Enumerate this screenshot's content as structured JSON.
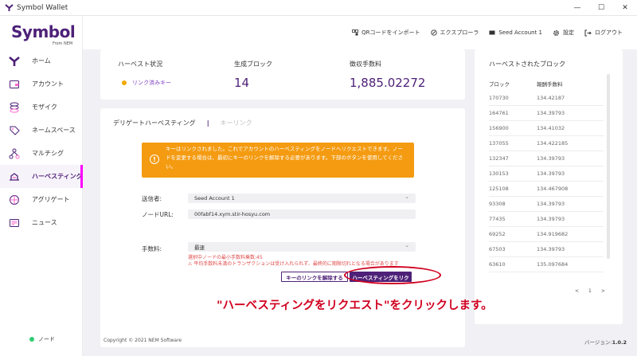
{
  "window": {
    "title": "Symbol Wallet",
    "minimize": "—",
    "maximize": "☐",
    "close": "✕"
  },
  "logo": {
    "word": "Symbol",
    "from": "From NEM"
  },
  "colors": {
    "brand": "#4e2178",
    "accent": "#ff00ff",
    "warning": "#f49b11",
    "annotation": "#d1001f",
    "link_dot": "#f2a900",
    "node_dot": "#2ecc71"
  },
  "sidebar": {
    "items": [
      {
        "label": "ホーム",
        "icon": "home-icon"
      },
      {
        "label": "アカウント",
        "icon": "account-icon"
      },
      {
        "label": "モザイク",
        "icon": "mosaic-icon"
      },
      {
        "label": "ネームスペース",
        "icon": "tag-icon"
      },
      {
        "label": "マルチシグ",
        "icon": "multisig-icon"
      },
      {
        "label": "ハーベスティング",
        "icon": "harvesting-icon"
      },
      {
        "label": "アグリゲート",
        "icon": "aggregate-icon"
      },
      {
        "label": "ニュース",
        "icon": "news-icon"
      }
    ],
    "active": "ハーベスティング",
    "node_label": "ノード"
  },
  "topbar": {
    "qr_import": "QRコードをインポート",
    "explorer": "エクスプローラ",
    "account": "Seed Account 1",
    "settings": "設定",
    "logout": "ログアウト"
  },
  "stats": {
    "status_label": "ハーベスト状況",
    "status_value": "リンク済みキー",
    "blocks_label": "生成ブロック",
    "blocks_value": "14",
    "fees_label": "徴収手数料",
    "fees_value": "1,885.02272"
  },
  "harvest": {
    "tab_delegated": "デリゲートハーベスティング",
    "tab_keylink": "キーリンク",
    "alert_text": "キーはリンクされました。これでアカウントのハーベスティングをノードへリクエストできます。ノードを変更する場合は、最初にキーのリンクを解除する必要があります。下部のボタンを使用してください。",
    "sender_label": "送信者:",
    "sender_value": "Seed Account 1",
    "node_url_label": "ノードURL:",
    "node_url_value": "00fabf14.xym.stir-hosyu.com",
    "fee_label": "手数料:",
    "fee_value": "最速",
    "fee_hint1": "選択中ノードの最小手数料乗数:45",
    "fee_hint2": "⚠ 平均手数料未満のトランザクションは受け入れられず、最終的に期限切れとなる場合があります",
    "unlink_button": "キーのリンクを解除する",
    "request_button": "ハーベスティングをリク"
  },
  "annotation": "\"ハーベスティングをリクエスト\"をクリックします。",
  "blocks": {
    "title": "ハーベストされたブロック",
    "columns": [
      "ブロック",
      "報酬手数料"
    ],
    "rows": [
      [
        "170730",
        "134.42187"
      ],
      [
        "164761",
        "134.39793"
      ],
      [
        "156900",
        "134.41032"
      ],
      [
        "137055",
        "134.422185"
      ],
      [
        "132347",
        "134.39793"
      ],
      [
        "130153",
        "134.39793"
      ],
      [
        "125108",
        "134.467908"
      ],
      [
        "93308",
        "134.39793"
      ],
      [
        "77435",
        "134.39793"
      ],
      [
        "69252",
        "134.919682"
      ],
      [
        "67503",
        "134.39793"
      ],
      [
        "63610",
        "135.097684"
      ]
    ],
    "pager_prev": "<",
    "pager_page": "1",
    "pager_next": ">"
  },
  "footer": {
    "copyright": "Copyright © 2021 NEM Software",
    "version_label": "バージョン:",
    "version_value": "1.0.2"
  }
}
